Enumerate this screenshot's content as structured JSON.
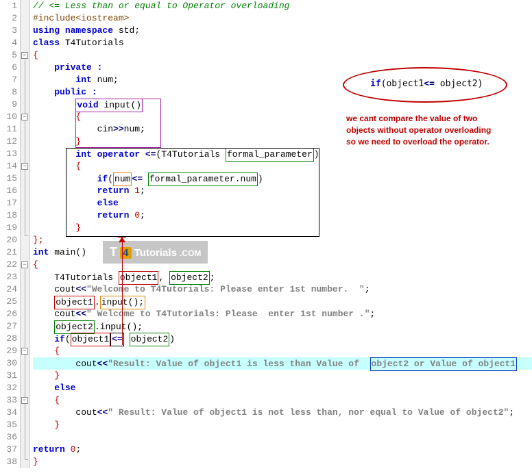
{
  "lines": {
    "l1": "// <= Less than or equal to Operator overloading",
    "l2a": "#include",
    "l2b": "<iostream>",
    "l3a": "using",
    "l3b": "namespace",
    "l3c": "std",
    "l4a": "class",
    "l4b": "T4Tutorials",
    "l5": "{",
    "l6": "private :",
    "l7a": "int",
    "l7b": "num",
    "l8": "public :",
    "l9a": "void",
    "l9b": "input()",
    "l10": "{",
    "l11a": "cin",
    "l11b": ">>",
    "l11c": "num",
    "l12": "}",
    "l13a": "int",
    "l13b": "operator",
    "l13c": "<=",
    "l13d": "T4Tutorials",
    "l13e": "formal_parameter",
    "l14": "{",
    "l15a": "if",
    "l15b": "num",
    "l15c": "<=",
    "l15d": "formal_parameter",
    "l15e": "num",
    "l16a": "return",
    "l16b": "1",
    "l17": "else",
    "l18a": "return",
    "l18b": "0",
    "l19": "}",
    "l20": "};",
    "l21a": "int",
    "l21b": "main()",
    "l22": "{",
    "l23a": "T4Tutorials",
    "l23b": "object1",
    "l23c": "object2",
    "l24a": "cout",
    "l24b": "<<",
    "l24c": "\"Welcome to T4Tutorials: Please enter 1st number.  \"",
    "l25a": "object1",
    "l25b": "input()",
    "l26a": "cout",
    "l26b": "<<",
    "l26c": "\" Welcome to T4Tutorials: Please  enter 1st number .\"",
    "l27a": "object2",
    "l27b": "input()",
    "l28a": "if",
    "l28b": "object1",
    "l28c": "<=",
    "l28d": "object2",
    "l29": "{",
    "l30a": "cout",
    "l30b": "<<",
    "l30c": "\"Result: Value of object1 is less than Value of  ",
    "l30d": "object2 or Value of object1",
    "l31": "}",
    "l32": "else",
    "l33": "{",
    "l34a": "cout",
    "l34b": "<<",
    "l34c": "\" Result: Value of object1 is not less than, nor equal to Value of object2\"",
    "l35": "}",
    "l36": "",
    "l37a": "return",
    "l37b": "0",
    "l38": "}"
  },
  "annotation": {
    "ellipse_code_a": "if",
    "ellipse_code_b": "object1",
    "ellipse_code_c": "<=",
    "ellipse_code_d": "object2",
    "text1": "we cant compare the value of two",
    "text2": "objects without operator overloading",
    "text3": "so we need to overload the operator."
  },
  "watermark": {
    "t": "T",
    "four": "4",
    "rest": "Tutorials",
    "dotcom": ".COM"
  },
  "line_numbers": [
    "1",
    "2",
    "3",
    "4",
    "5",
    "6",
    "7",
    "8",
    "9",
    "10",
    "11",
    "12",
    "13",
    "14",
    "15",
    "16",
    "17",
    "18",
    "19",
    "20",
    "21",
    "22",
    "23",
    "24",
    "25",
    "26",
    "27",
    "28",
    "29",
    "30",
    "31",
    "32",
    "33",
    "34",
    "35",
    "36",
    "37",
    "38"
  ]
}
